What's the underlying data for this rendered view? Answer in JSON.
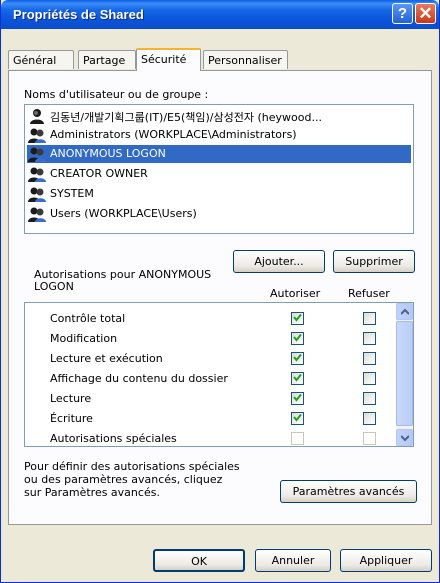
{
  "window": {
    "title": "Propriétés de Shared",
    "help_glyph": "?",
    "close_glyph": "✕"
  },
  "tabs": [
    {
      "label": "Général"
    },
    {
      "label": "Partage"
    },
    {
      "label": "Sécurité",
      "active": true
    },
    {
      "label": "Personnaliser"
    }
  ],
  "users_label": "Noms d'utilisateur ou de groupe :",
  "users": [
    {
      "label": "김동년/개발기획그룹(IT)/E5(책임)/삼성전자 (heywood...",
      "icon": "user-icon"
    },
    {
      "label": "Administrators (WORKPLACE\\Administrators)",
      "icon": "group-icon"
    },
    {
      "label": "ANONYMOUS LOGON",
      "icon": "group-icon",
      "selected": true
    },
    {
      "label": "CREATOR OWNER",
      "icon": "group-icon"
    },
    {
      "label": "SYSTEM",
      "icon": "group-icon"
    },
    {
      "label": "Users (WORKPLACE\\Users)",
      "icon": "group-icon"
    }
  ],
  "buttons": {
    "add": "Ajouter...",
    "remove": "Supprimer",
    "advanced": "Paramètres avancés",
    "ok": "OK",
    "cancel": "Annuler",
    "apply": "Appliquer"
  },
  "permissions": {
    "title_line1": "Autorisations pour ANONYMOUS",
    "title_line2": "LOGON",
    "col_allow": "Autoriser",
    "col_deny": "Refuser",
    "rows": [
      {
        "name": "Contrôle total",
        "allow": true,
        "deny": false
      },
      {
        "name": "Modification",
        "allow": true,
        "deny": false
      },
      {
        "name": "Lecture et exécution",
        "allow": true,
        "deny": false
      },
      {
        "name": "Affichage du contenu du dossier",
        "allow": true,
        "deny": false
      },
      {
        "name": "Lecture",
        "allow": true,
        "deny": false
      },
      {
        "name": "Écriture",
        "allow": true,
        "deny": false
      },
      {
        "name": "Autorisations spéciales",
        "allow": false,
        "deny": false,
        "dim": true
      }
    ]
  },
  "advanced_note": {
    "line1": "Pour définir des autorisations spéciales",
    "line2": "ou des paramètres avancés, cliquez",
    "line3": "sur Paramètres avancés."
  },
  "colors": {
    "title_blue": "#0A53DA",
    "selection": "#316AC5",
    "face": "#ECE9D8",
    "check_green": "#21A121"
  }
}
